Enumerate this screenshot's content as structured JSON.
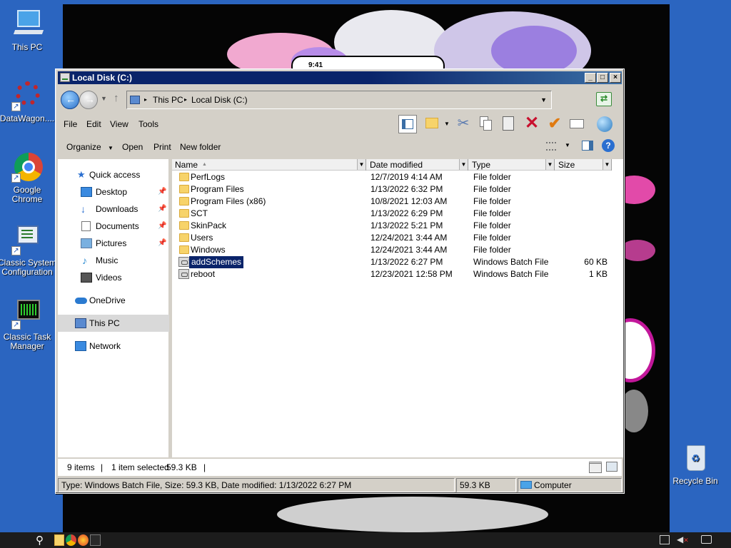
{
  "desktop": {
    "icons": [
      {
        "label": "This PC",
        "icon": "this-pc-icon"
      },
      {
        "label": "DataWagon....",
        "icon": "datawagon-icon"
      },
      {
        "label": "Google Chrome",
        "icon": "chrome-icon"
      },
      {
        "label": "Classic System Configuration",
        "icon": "sysconfig-icon"
      },
      {
        "label": "Classic Task Manager",
        "icon": "taskmanager-icon"
      },
      {
        "label": "Recycle Bin",
        "icon": "recycle-bin-icon"
      }
    ],
    "phone_time": "9:41"
  },
  "window": {
    "title": "Local Disk (C:)",
    "controls": {
      "minimize": "_",
      "maximize": "□",
      "close": "×"
    },
    "address": {
      "root_label": "This PC",
      "separator": "▸",
      "current": "Local Disk (C:)"
    },
    "menu": [
      "File",
      "Edit",
      "View",
      "Tools"
    ],
    "commands": {
      "organize": "Organize",
      "open": "Open",
      "print": "Print",
      "new_folder": "New folder"
    }
  },
  "nav": {
    "items": [
      {
        "label": "Quick access",
        "icon": "star-icon"
      },
      {
        "label": "Desktop",
        "icon": "desktop-icon",
        "pinned": true
      },
      {
        "label": "Downloads",
        "icon": "downloads-icon",
        "pinned": true
      },
      {
        "label": "Documents",
        "icon": "documents-icon",
        "pinned": true
      },
      {
        "label": "Pictures",
        "icon": "pictures-icon",
        "pinned": true
      },
      {
        "label": "Music",
        "icon": "music-icon"
      },
      {
        "label": "Videos",
        "icon": "videos-icon"
      },
      {
        "label": "OneDrive",
        "icon": "onedrive-icon"
      },
      {
        "label": "This PC",
        "icon": "this-pc-icon",
        "selected": true
      },
      {
        "label": "Network",
        "icon": "network-icon"
      }
    ]
  },
  "filelist": {
    "columns": [
      "Name",
      "Date modified",
      "Type",
      "Size"
    ],
    "rows": [
      {
        "name": "PerfLogs",
        "date": "12/7/2019 4:14 AM",
        "type": "File folder",
        "size": "",
        "kind": "folder"
      },
      {
        "name": "Program Files",
        "date": "1/13/2022 6:32 PM",
        "type": "File folder",
        "size": "",
        "kind": "folder"
      },
      {
        "name": "Program Files (x86)",
        "date": "10/8/2021 12:03 AM",
        "type": "File folder",
        "size": "",
        "kind": "folder"
      },
      {
        "name": "SCT",
        "date": "1/13/2022 6:29 PM",
        "type": "File folder",
        "size": "",
        "kind": "folder"
      },
      {
        "name": "SkinPack",
        "date": "1/13/2022 5:21 PM",
        "type": "File folder",
        "size": "",
        "kind": "folder"
      },
      {
        "name": "Users",
        "date": "12/24/2021 3:44 AM",
        "type": "File folder",
        "size": "",
        "kind": "folder"
      },
      {
        "name": "Windows",
        "date": "12/24/2021 3:44 AM",
        "type": "File folder",
        "size": "",
        "kind": "folder"
      },
      {
        "name": "addSchemes",
        "date": "1/13/2022 6:27 PM",
        "type": "Windows Batch File",
        "size": "60 KB",
        "kind": "batch",
        "selected": true
      },
      {
        "name": "reboot",
        "date": "12/23/2021 12:58 PM",
        "type": "Windows Batch File",
        "size": "1 KB",
        "kind": "batch"
      }
    ]
  },
  "status": {
    "item_count": "9 items",
    "selection": "1 item selected",
    "selection_size": "59.3 KB",
    "separator": "|",
    "details": "Type: Windows Batch File, Size: 59.3 KB, Date modified: 1/13/2022 6:27 PM",
    "size_panel": "59.3 KB",
    "location": "Computer"
  }
}
